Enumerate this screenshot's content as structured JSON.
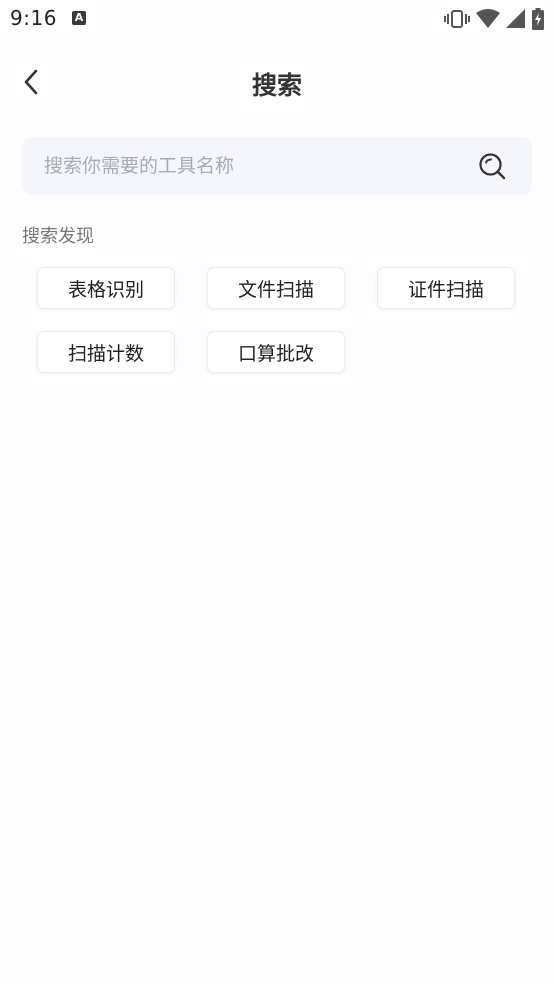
{
  "status_bar": {
    "time": "9:16",
    "notification_letter": "A",
    "icons": [
      "vibrate-icon",
      "wifi-icon",
      "signal-icon",
      "battery-charging-icon"
    ]
  },
  "header": {
    "title": "搜索",
    "back_icon": "chevron-left-icon"
  },
  "search": {
    "placeholder": "搜索你需要的工具名称",
    "value": "",
    "icon": "search-icon"
  },
  "discover": {
    "title": "搜索发现",
    "tags": [
      {
        "label": "表格识别"
      },
      {
        "label": "文件扫描"
      },
      {
        "label": "证件扫描"
      },
      {
        "label": "扫描计数"
      },
      {
        "label": "口算批改"
      }
    ]
  },
  "colors": {
    "background": "#fdfcfe",
    "search_bg": "#f5f6fb",
    "placeholder": "#a9abb3",
    "tag_border": "#ececf0"
  }
}
